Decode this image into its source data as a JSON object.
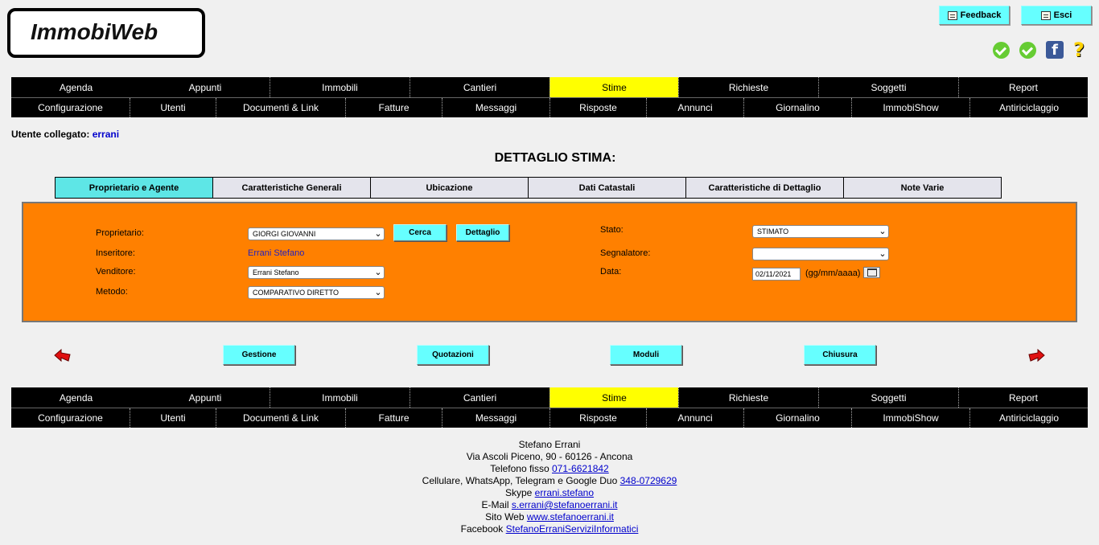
{
  "header": {
    "logo_text": "ImmobiWeb",
    "feedback_label": "Feedback",
    "esci_label": "Esci"
  },
  "nav": {
    "row1": [
      "Agenda",
      "Appunti",
      "Immobili",
      "Cantieri",
      "Stime",
      "Richieste",
      "Soggetti",
      "Report"
    ],
    "row2": [
      "Configurazione",
      "Utenti",
      "Documenti & Link",
      "Fatture",
      "Messaggi",
      "Risposte",
      "Annunci",
      "Giornalino",
      "ImmobiShow",
      "Antiriciclaggio"
    ],
    "active": "Stime"
  },
  "user": {
    "label": "Utente collegato:",
    "name": "errani"
  },
  "page_title": "DETTAGLIO STIMA:",
  "tabs": [
    "Proprietario e Agente",
    "Caratteristiche Generali",
    "Ubicazione",
    "Dati Catastali",
    "Caratteristiche di Dettaglio",
    "Note Varie"
  ],
  "form": {
    "proprietario_label": "Proprietario:",
    "proprietario_value": "GIORGI GIOVANNI",
    "cerca_label": "Cerca",
    "dettaglio_label": "Dettaglio",
    "inseritore_label": "Inseritore:",
    "inseritore_value": "Errani Stefano",
    "venditore_label": "Venditore:",
    "venditore_value": "Errani Stefano",
    "metodo_label": "Metodo:",
    "metodo_value": "COMPARATIVO DIRETTO",
    "stato_label": "Stato:",
    "stato_value": "STIMATO",
    "segnalatore_label": "Segnalatore:",
    "segnalatore_value": "",
    "data_label": "Data:",
    "data_value": "02/11/2021",
    "data_format": "(gg/mm/aaaa)"
  },
  "actions": {
    "gestione": "Gestione",
    "quotazioni": "Quotazioni",
    "moduli": "Moduli",
    "chiusura": "Chiusura"
  },
  "footer": {
    "name": "Stefano Errani",
    "address": "Via Ascoli Piceno, 90 - 60126 - Ancona",
    "phone_label": "Telefono fisso",
    "phone": "071-6621842",
    "mobile_label": "Cellulare, WhatsApp, Telegram e Google Duo",
    "mobile": "348-0729629",
    "skype_label": "Skype",
    "skype": "errani.stefano",
    "email_label": "E-Mail",
    "email": "s.errani@stefanoerrani.it",
    "web_label": "Sito Web",
    "web": "www.stefanoerrani.it",
    "facebook_label": "Facebook",
    "facebook": "StefanoErraniServiziInformatici"
  },
  "colors": {
    "nav_bg": "#000000",
    "nav_active": "#ffff00",
    "button": "#66ffff",
    "panel": "#ff8000",
    "tab_active": "#5ee6e6"
  },
  "icons": [
    "check-icon",
    "check-icon",
    "facebook-icon",
    "help-icon",
    "back-arrow-icon",
    "forward-arrow-icon",
    "calendar-icon"
  ]
}
